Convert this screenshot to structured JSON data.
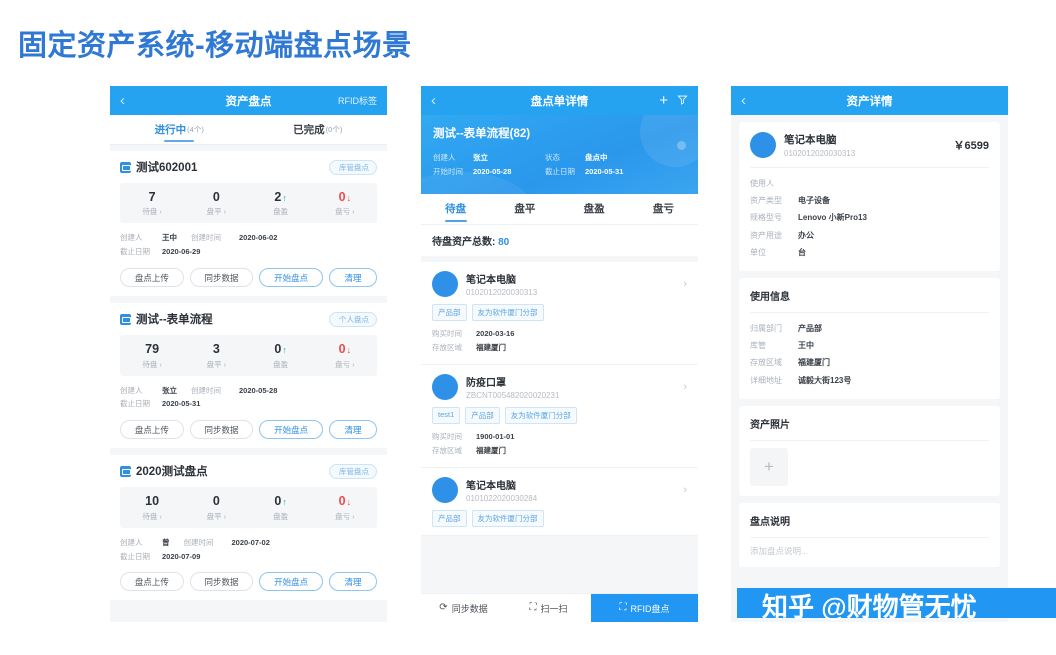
{
  "page": {
    "title": "固定资产系统-移动端盘点场景",
    "accent": "#2f78d4"
  },
  "watermark": {
    "text": "知乎 @财物管无忧",
    "bar_color": "#2196f3"
  },
  "panel1": {
    "nav": {
      "back": "‹",
      "title": "资产盘点",
      "right_label": "RFID标签"
    },
    "tabs": [
      {
        "label": "进行中",
        "count": "(4个)",
        "active": true
      },
      {
        "label": "已完成",
        "count": "(0个)",
        "active": false
      }
    ],
    "stat_labels": [
      "待盘 ›",
      "盘平 ›",
      "盘盈",
      "盘亏 ›"
    ],
    "meta_labels": {
      "creator": "创建人",
      "created": "创建时间",
      "deadline": "截止日期"
    },
    "actions": [
      "盘点上传",
      "同步数据",
      "开始盘点",
      "清理"
    ],
    "cards": [
      {
        "title": "测试602001",
        "badge": "库管盘点",
        "stats": [
          "7",
          "0",
          "2",
          "0"
        ],
        "creator": "王中",
        "created": "2020-06-02",
        "deadline": "2020-06-29"
      },
      {
        "title": "测试--表单流程",
        "badge": "个人盘点",
        "stats": [
          "79",
          "3",
          "0",
          "0"
        ],
        "creator": "张立",
        "created": "2020-05-28",
        "deadline": "2020-05-31"
      },
      {
        "title": "2020测试盘点",
        "badge": "库管盘点",
        "stats": [
          "10",
          "0",
          "0",
          "0"
        ],
        "creator": "曾",
        "created": "2020-07-02",
        "deadline": "2020-07-09"
      }
    ]
  },
  "panel2": {
    "nav": {
      "back": "‹",
      "title": "盘点单详情",
      "add": "+",
      "filter": "filter"
    },
    "hero": {
      "title": "测试--表单流程(82)",
      "creator_label": "创建人",
      "creator": "张立",
      "status_label": "状态",
      "status": "盘点中",
      "start_label": "开始时间",
      "start": "2020-05-28",
      "deadline_label": "截止日期",
      "deadline": "2020-05-31"
    },
    "tabs": [
      {
        "label": "待盘",
        "active": true
      },
      {
        "label": "盘平",
        "active": false
      },
      {
        "label": "盘盈",
        "active": false
      },
      {
        "label": "盘亏",
        "active": false
      }
    ],
    "total": {
      "label": "待盘资产总数:",
      "value": "80"
    },
    "item_labels": {
      "buy_time": "购买时间",
      "area": "存放区域"
    },
    "items": [
      {
        "name": "笔记本电脑",
        "code": "0102012020030313",
        "tags": [
          "产品部",
          "友为软件厦门分部"
        ],
        "buy_time": "2020-03-16",
        "area": "福建厦门"
      },
      {
        "name": "防疫口罩",
        "code": "ZBCNT005482020020231",
        "tags": [
          "test1",
          "产品部",
          "友为软件厦门分部"
        ],
        "buy_time": "1900-01-01",
        "area": "福建厦门"
      },
      {
        "name": "笔记本电脑",
        "code": "0101022020030284",
        "tags": [
          "产品部",
          "友为软件厦门分部"
        ],
        "buy_time": "",
        "area": ""
      }
    ],
    "bottom": [
      {
        "label": "同步数据",
        "icon": "refresh-icon",
        "accent": false
      },
      {
        "label": "扫一扫",
        "icon": "scan-icon",
        "accent": false
      },
      {
        "label": "RFID盘点",
        "icon": "rfid-icon",
        "accent": true
      }
    ]
  },
  "panel3": {
    "nav": {
      "back": "‹",
      "title": "资产详情"
    },
    "asset": {
      "name": "笔记本电脑",
      "code": "0102012020030313",
      "price": "￥6599"
    },
    "basic": [
      {
        "k": "使用人",
        "v": ""
      },
      {
        "k": "资产类型",
        "v": "电子设备"
      },
      {
        "k": "规格型号",
        "v": "Lenovo 小新Pro13"
      },
      {
        "k": "资产用途",
        "v": "办公"
      },
      {
        "k": "单位",
        "v": "台"
      }
    ],
    "usage_title": "使用信息",
    "usage": [
      {
        "k": "归属部门",
        "v": "产品部"
      },
      {
        "k": "库管",
        "v": "王中"
      },
      {
        "k": "存放区域",
        "v": "福建厦门"
      },
      {
        "k": "详细地址",
        "v": "诚毅大街123号"
      }
    ],
    "photos_title": "资产照片",
    "photo_add": "+",
    "note_title": "盘点说明",
    "note_placeholder": "添加盘点说明..."
  }
}
